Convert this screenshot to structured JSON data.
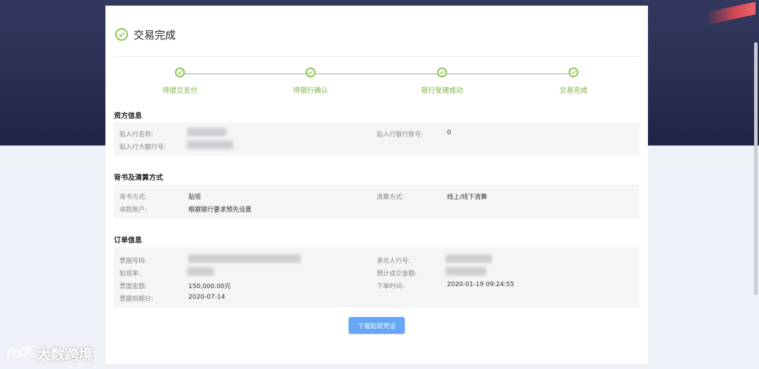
{
  "title": "交易完成",
  "steps": [
    "待提交支付",
    "待银行确认",
    "银行受理成功",
    "交易完成"
  ],
  "sections": {
    "bank": {
      "title": "资方信息",
      "bank_name_label": "贴入行名称:",
      "bank_no_label": "贴入行大额行号:",
      "account_label": "贴入行银行账号:",
      "account_value": "0"
    },
    "endorse": {
      "title": "背书及清算方式",
      "method_label": "背书方式:",
      "method_value": "贴现",
      "account_label": "收款账户:",
      "account_value": "根据银行要求预先设置",
      "clearing_label": "清算方式:",
      "clearing_value": "线上/线下清算"
    },
    "order": {
      "title": "订单信息",
      "bill_no_label": "票据号码:",
      "rate_label": "贴现率:",
      "amount_label": "票面金额:",
      "amount_value": "150,000.00元",
      "due_label": "票据到期日:",
      "due_value": "2020-07-14",
      "acceptor_label": "承兑人行号:",
      "estimate_label": "预计成交金额:",
      "time_label": "下单时间:",
      "time_value": "2020-01-19 09:24:55"
    }
  },
  "download_button": "下载贴现凭证",
  "watermark": "大数跨境",
  "colors": {
    "accent_green": "#8bc34a",
    "button_blue": "#66a6f5"
  }
}
